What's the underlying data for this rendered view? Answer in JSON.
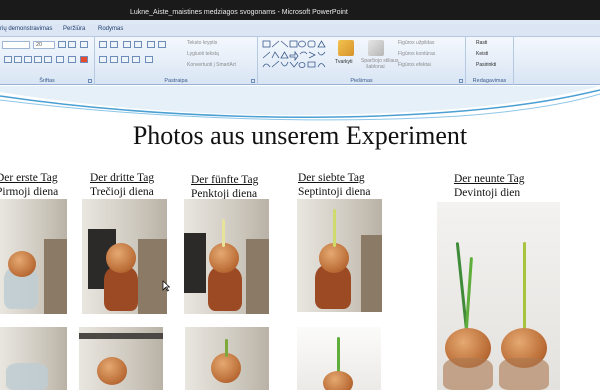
{
  "window": {
    "title": "Lukne_Aiste_maistines medziagos svogonams - Microsoft PowerPoint"
  },
  "ribbon": {
    "tabs": [
      "rių demonstravimas",
      "Peržiūra",
      "Rodymas"
    ],
    "font_size": "20",
    "groups": {
      "font": "Šriftas",
      "paragraph": "Pastraipa",
      "drawing": "Piešimas",
      "editing": "Redagavimas"
    },
    "paragraph": {
      "text_direction": "Teksto kryptis",
      "align_text": "Lygiuoti tekstą",
      "convert_smartart": "Konvertuoti į SmartArt"
    },
    "drawing": {
      "arrange": "Tvarkyti",
      "quick_styles_1": "Sparčiojo stiliaus",
      "quick_styles_2": "šablonai",
      "shape_fill": "Figūros užpildas",
      "shape_outline": "Figūros kontūras",
      "shape_effects": "Figūros efektai"
    },
    "editing": {
      "find": "Rasti",
      "replace": "Keisti",
      "select": "Pasirinkti"
    }
  },
  "slide": {
    "title": "Photos aus unserem Experiment",
    "captions": [
      {
        "de": "Der erste Tag",
        "lt": "Pirmoji diena"
      },
      {
        "de": "Der dritte Tag",
        "lt": "Trečioji diena"
      },
      {
        "de": "Der fünfte Tag",
        "lt": "Penktoji diena"
      },
      {
        "de": "Der siebte Tag",
        "lt": "Septintoji diena"
      },
      {
        "de": "Der neunte Tag",
        "lt": "Devintoji dien"
      }
    ]
  },
  "colors": {
    "titlebar": "#1a1a1a",
    "ribbon": "#dbe5f3",
    "wave": "#2a7fb8",
    "onion": "#c47a3e",
    "sprout": "#5fae3c"
  }
}
